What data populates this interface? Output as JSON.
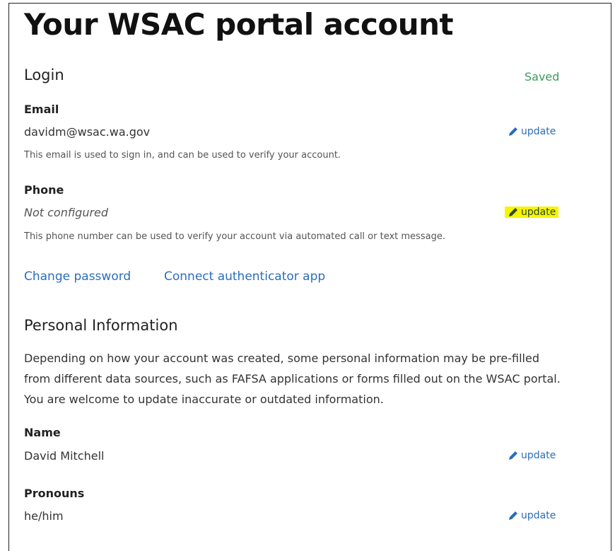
{
  "page": {
    "title": "Your WSAC portal account"
  },
  "login": {
    "heading": "Login",
    "status": "Saved",
    "email": {
      "label": "Email",
      "value": "davidm@wsac.wa.gov",
      "update_label": "update",
      "help": "This email is used to sign in, and can be used to verify your account."
    },
    "phone": {
      "label": "Phone",
      "value": "Not configured",
      "update_label": "update",
      "help": "This phone number can be used to verify your account via automated call or text message."
    },
    "links": {
      "change_password": "Change password",
      "connect_authenticator": "Connect authenticator app"
    }
  },
  "personal": {
    "heading": "Personal Information",
    "description": "Depending on how your account was created, some personal information may be pre-filled from different data sources, such as FAFSA applications or forms filled out on the WSAC portal. You are welcome to update inaccurate or outdated information.",
    "name": {
      "label": "Name",
      "value": "David Mitchell",
      "update_label": "update"
    },
    "pronouns": {
      "label": "Pronouns",
      "value": "he/him",
      "update_label": "update"
    }
  },
  "colors": {
    "link": "#2a6ebb",
    "saved": "#3c9a5f",
    "highlight": "#f7f500"
  },
  "icons": {
    "update": "pencil-icon"
  }
}
